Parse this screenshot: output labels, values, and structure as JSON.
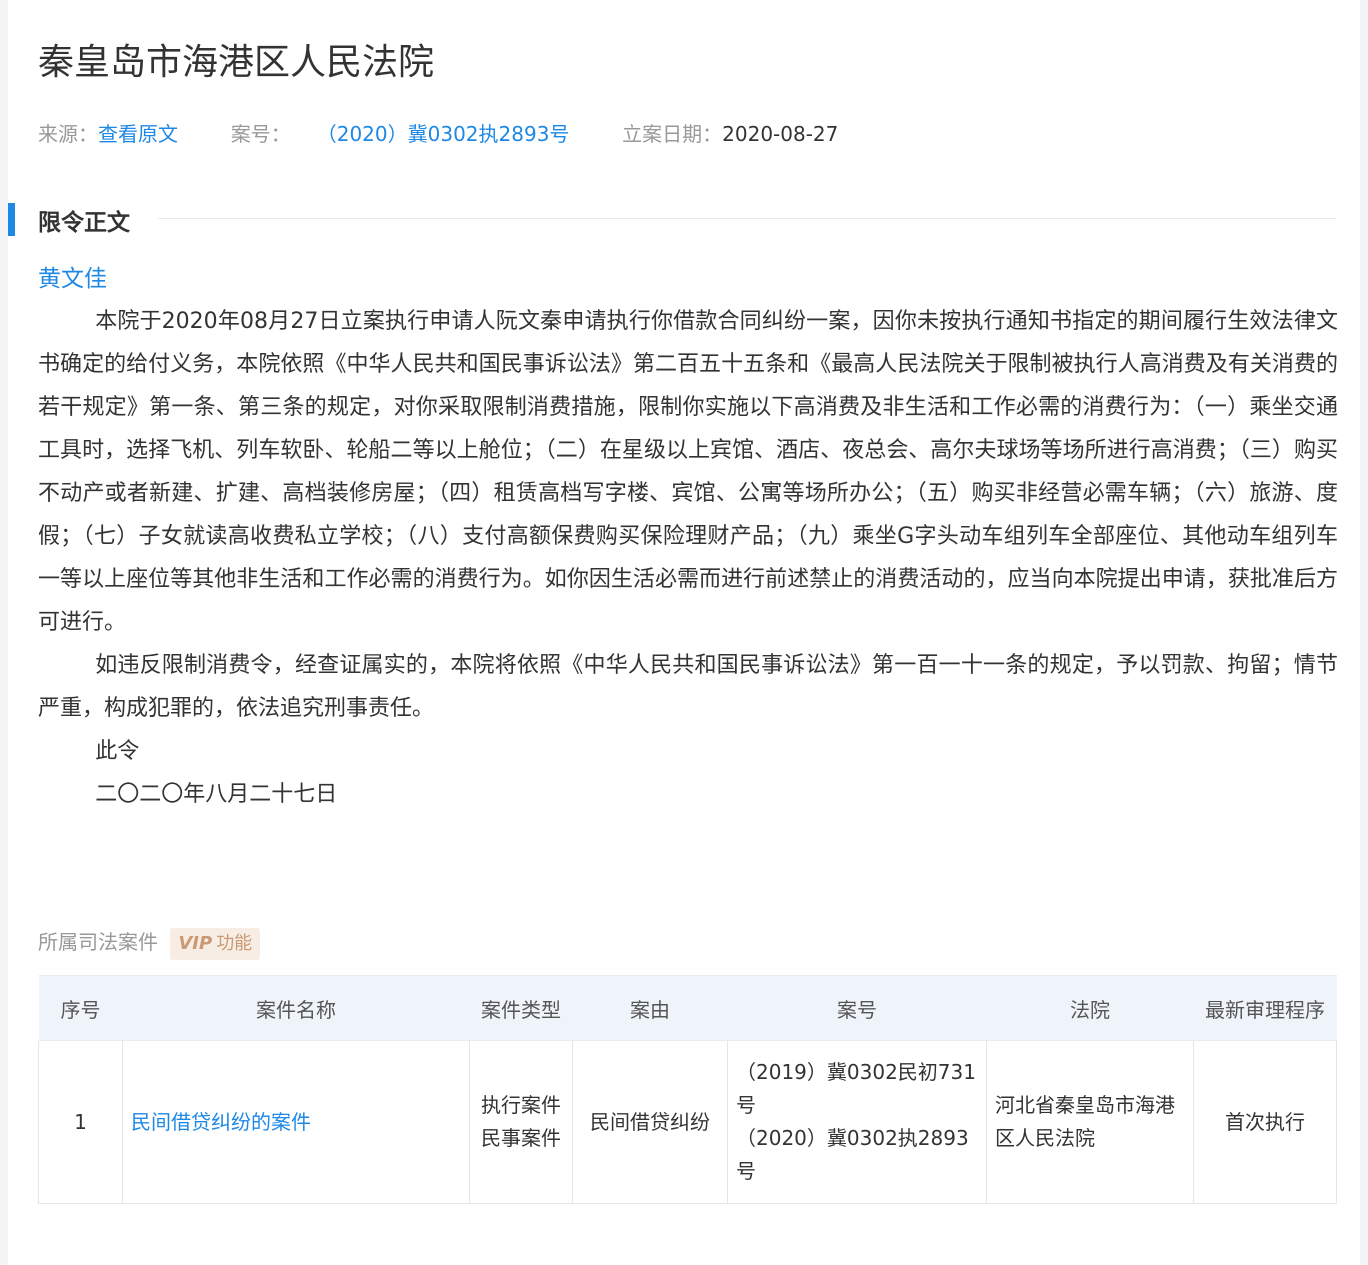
{
  "title": "秦皇岛市海港区人民法院",
  "meta": {
    "source_label": "来源：",
    "source_link": "查看原文",
    "case_no_label": "案号：",
    "case_no": "（2020）冀0302执2893号",
    "filing_date_label": "立案日期：",
    "filing_date": "2020-08-27"
  },
  "section": {
    "title": "限令正文",
    "addressee": "黄文佳",
    "paragraphs": [
      "本院于2020年08月27日立案执行申请人阮文秦申请执行你借款合同纠纷一案，因你未按执行通知书指定的期间履行生效法律文书确定的给付义务，本院依照《中华人民共和国民事诉讼法》第二百五十五条和《最高人民法院关于限制被执行人高消费及有关消费的若干规定》第一条、第三条的规定，对你采取限制消费措施，限制你实施以下高消费及非生活和工作必需的消费行为：（一）乘坐交通工具时，选择飞机、列车软卧、轮船二等以上舱位；（二）在星级以上宾馆、酒店、夜总会、高尔夫球场等场所进行高消费；（三）购买不动产或者新建、扩建、高档装修房屋；（四）租赁高档写字楼、宾馆、公寓等场所办公；（五）购买非经营必需车辆；（六）旅游、度假；（七）子女就读高收费私立学校；（八）支付高额保费购买保险理财产品；（九）乘坐G字头动车组列车全部座位、其他动车组列车一等以上座位等其他非生活和工作必需的消费行为。如你因生活必需而进行前述禁止的消费活动的，应当向本院提出申请，获批准后方可进行。",
      "如违反限制消费令，经查证属实的，本院将依照《中华人民共和国民事诉讼法》第一百一十一条的规定，予以罚款、拘留；情节严重，构成犯罪的，依法追究刑事责任。",
      "此令",
      "二〇二〇年八月二十七日"
    ]
  },
  "related": {
    "label": "所属司法案件",
    "vip_mark": "VIP",
    "vip_text": "功能"
  },
  "table": {
    "headers": [
      "序号",
      "案件名称",
      "案件类型",
      "案由",
      "案号",
      "法院",
      "最新审理程序"
    ],
    "rows": [
      {
        "index": "1",
        "name": "民间借贷纠纷的案件",
        "types": [
          "执行案件",
          "民事案件"
        ],
        "cause": "民间借贷纠纷",
        "case_nos": [
          "（2019）冀0302民初731号",
          "（2020）冀0302执2893号"
        ],
        "court": "河北省秦皇岛市海港区人民法院",
        "procedure": "首次执行"
      }
    ]
  },
  "colors": {
    "accent": "#1e88e5",
    "vip_bg": "#f7ede4",
    "vip_text": "#c99a74",
    "table_header_bg": "#eef4fa"
  }
}
